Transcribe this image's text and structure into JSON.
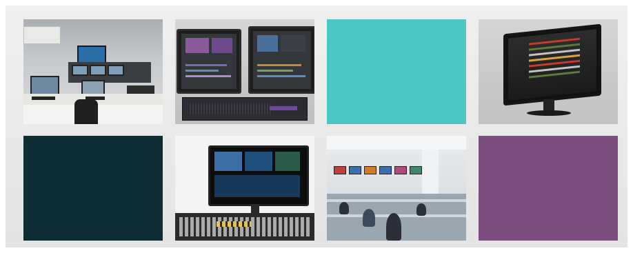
{
  "gallery": {
    "tiles": [
      {
        "id": "control-room-photo",
        "kind": "image"
      },
      {
        "id": "editing-workstation-photo",
        "kind": "image"
      },
      {
        "id": "teal-block",
        "kind": "color",
        "color": "#4bc8c4"
      },
      {
        "id": "monitor-software-photo",
        "kind": "image"
      },
      {
        "id": "navy-block",
        "kind": "color",
        "color": "#0e2d35"
      },
      {
        "id": "production-switcher-photo",
        "kind": "image"
      },
      {
        "id": "newsroom-photo",
        "kind": "image"
      },
      {
        "id": "plum-block",
        "kind": "color",
        "color": "#7b4d80"
      }
    ]
  },
  "colors": {
    "frame_background": "#e9e9e9",
    "teal": "#4bc8c4",
    "navy": "#0e2d35",
    "plum": "#7b4d80"
  }
}
